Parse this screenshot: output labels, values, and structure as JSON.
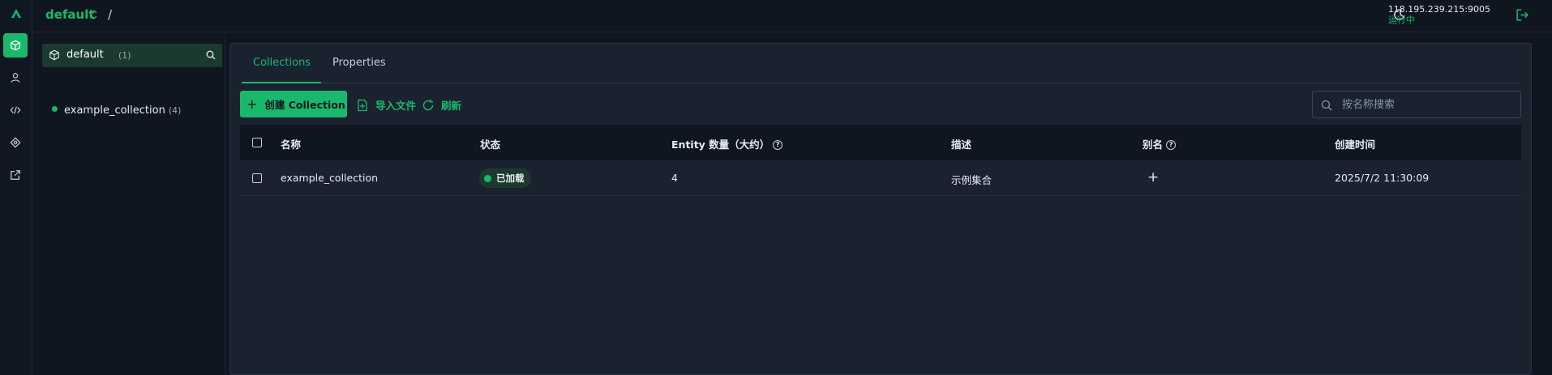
{
  "colors": {
    "accent": "#19b96b",
    "panel": "#1a2230",
    "background": "#0f1620"
  },
  "topbar": {
    "db_name": "default",
    "breadcrumb_separator": "/",
    "host": "118.195.239.215:9005",
    "status": "运行中"
  },
  "rail": {
    "items": [
      {
        "icon": "database-cube-icon",
        "active": true
      },
      {
        "icon": "user-icon",
        "active": false
      },
      {
        "icon": "code-icon",
        "active": false
      },
      {
        "icon": "network-icon",
        "active": false
      },
      {
        "icon": "external-link-icon",
        "active": false
      }
    ]
  },
  "tree": {
    "database": {
      "name": "default",
      "count": "(1)"
    },
    "collections": [
      {
        "name": "example_collection",
        "count": "(4)"
      }
    ]
  },
  "tabs": [
    {
      "label": "Collections",
      "active": true
    },
    {
      "label": "Properties",
      "active": false
    }
  ],
  "toolbar": {
    "create_label": "创建 Collection",
    "import_label": "导入文件",
    "refresh_label": "刷新",
    "search_placeholder": "按名称搜索",
    "search_value": ""
  },
  "table": {
    "headers": {
      "name": "名称",
      "status": "状态",
      "entity_count": "Entity 数量（大约）",
      "description": "描述",
      "alias": "别名",
      "created": "创建时间"
    },
    "rows": [
      {
        "name": "example_collection",
        "status": "已加载",
        "entity_count": "4",
        "description": "示例集合",
        "alias": "+",
        "created": "2025/7/2 11:30:09"
      }
    ]
  }
}
